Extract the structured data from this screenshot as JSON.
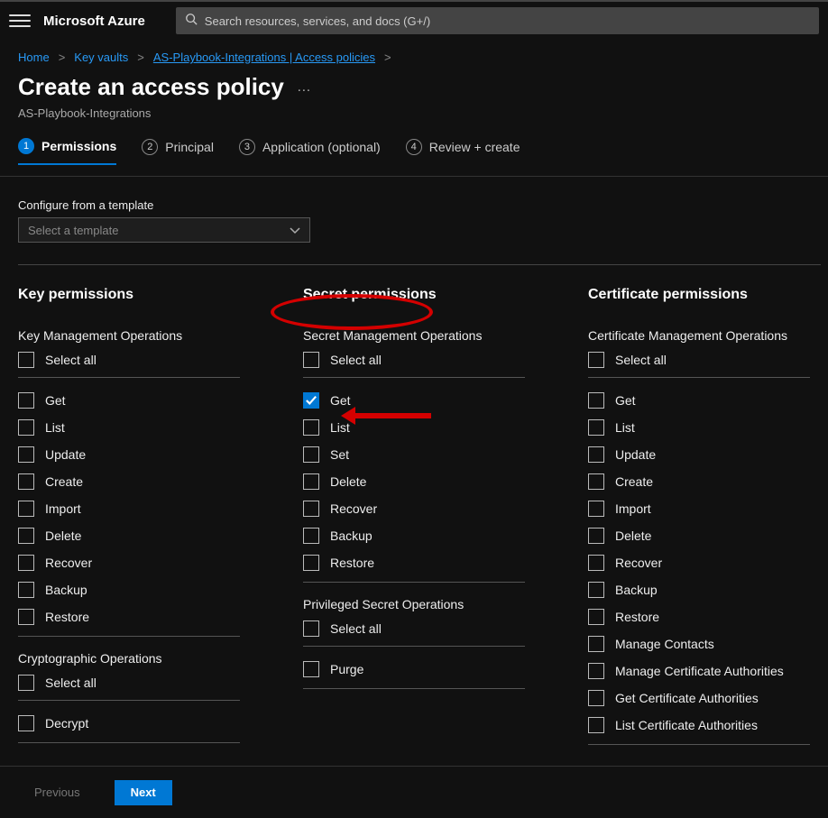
{
  "brand": "Microsoft Azure",
  "search": {
    "placeholder": "Search resources, services, and docs (G+/)"
  },
  "breadcrumb": {
    "items": [
      "Home",
      "Key vaults",
      "AS-Playbook-Integrations | Access policies"
    ],
    "sep": ">"
  },
  "title": "Create an access policy",
  "subtitle": "AS-Playbook-Integrations",
  "wizard": [
    {
      "num": "1",
      "label": "Permissions",
      "active": true
    },
    {
      "num": "2",
      "label": "Principal",
      "active": false
    },
    {
      "num": "3",
      "label": "Application (optional)",
      "active": false
    },
    {
      "num": "4",
      "label": "Review + create",
      "active": false
    }
  ],
  "template": {
    "label": "Configure from a template",
    "placeholder": "Select a template"
  },
  "select_all": "Select all",
  "columns": [
    {
      "title": "Key permissions",
      "groups": [
        {
          "title": "Key Management Operations",
          "items": [
            {
              "label": "Get",
              "checked": false
            },
            {
              "label": "List",
              "checked": false
            },
            {
              "label": "Update",
              "checked": false
            },
            {
              "label": "Create",
              "checked": false
            },
            {
              "label": "Import",
              "checked": false
            },
            {
              "label": "Delete",
              "checked": false
            },
            {
              "label": "Recover",
              "checked": false
            },
            {
              "label": "Backup",
              "checked": false
            },
            {
              "label": "Restore",
              "checked": false
            }
          ]
        },
        {
          "title": "Cryptographic Operations",
          "items": [
            {
              "label": "Decrypt",
              "checked": false
            }
          ]
        }
      ]
    },
    {
      "title": "Secret permissions",
      "groups": [
        {
          "title": "Secret Management Operations",
          "items": [
            {
              "label": "Get",
              "checked": true
            },
            {
              "label": "List",
              "checked": false
            },
            {
              "label": "Set",
              "checked": false
            },
            {
              "label": "Delete",
              "checked": false
            },
            {
              "label": "Recover",
              "checked": false
            },
            {
              "label": "Backup",
              "checked": false
            },
            {
              "label": "Restore",
              "checked": false
            }
          ]
        },
        {
          "title": "Privileged Secret Operations",
          "items": [
            {
              "label": "Purge",
              "checked": false
            }
          ]
        }
      ]
    },
    {
      "title": "Certificate permissions",
      "groups": [
        {
          "title": "Certificate Management Operations",
          "items": [
            {
              "label": "Get",
              "checked": false
            },
            {
              "label": "List",
              "checked": false
            },
            {
              "label": "Update",
              "checked": false
            },
            {
              "label": "Create",
              "checked": false
            },
            {
              "label": "Import",
              "checked": false
            },
            {
              "label": "Delete",
              "checked": false
            },
            {
              "label": "Recover",
              "checked": false
            },
            {
              "label": "Backup",
              "checked": false
            },
            {
              "label": "Restore",
              "checked": false
            },
            {
              "label": "Manage Contacts",
              "checked": false
            },
            {
              "label": "Manage Certificate Authorities",
              "checked": false
            },
            {
              "label": "Get Certificate Authorities",
              "checked": false
            },
            {
              "label": "List Certificate Authorities",
              "checked": false
            }
          ]
        }
      ]
    }
  ],
  "footer": {
    "prev": "Previous",
    "next": "Next"
  }
}
